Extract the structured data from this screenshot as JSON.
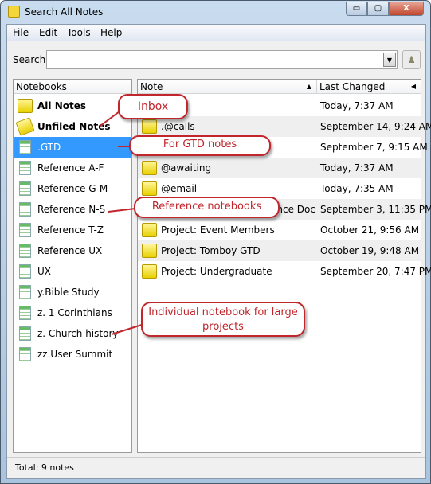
{
  "window": {
    "title": "Search All Notes",
    "buttons": {
      "minimize": "▭",
      "maximize": "▢",
      "close": "X"
    }
  },
  "menu": [
    {
      "label": "File",
      "key": "F",
      "rest": "ile"
    },
    {
      "label": "Edit",
      "key": "E",
      "rest": "dit"
    },
    {
      "label": "Tools",
      "key": "T",
      "rest": "ools"
    },
    {
      "label": "Help",
      "key": "H",
      "rest": "elp"
    }
  ],
  "search": {
    "label": "Search:",
    "value": "",
    "placeholder": ""
  },
  "notebooks": {
    "header": "Notebooks",
    "items": [
      {
        "label": "All Notes",
        "bold": true,
        "icon": "folder-icon"
      },
      {
        "label": "Unfiled Notes",
        "bold": true,
        "icon": "unfiled-folder-icon"
      },
      {
        "label": ".GTD",
        "selected": true,
        "icon": "notebook-icon"
      },
      {
        "label": "Reference A-F",
        "icon": "notebook-icon"
      },
      {
        "label": "Reference G-M",
        "icon": "notebook-icon"
      },
      {
        "label": "Reference N-S",
        "icon": "notebook-icon"
      },
      {
        "label": "Reference T-Z",
        "icon": "notebook-icon"
      },
      {
        "label": "Reference UX",
        "icon": "notebook-icon"
      },
      {
        "label": "UX",
        "icon": "notebook-icon"
      },
      {
        "label": "y.Bible Study",
        "icon": "notebook-icon"
      },
      {
        "label": "z. 1 Corinthians",
        "icon": "notebook-icon"
      },
      {
        "label": "z. Church history",
        "icon": "notebook-icon"
      },
      {
        "label": "zz.User Summit",
        "icon": "notebook-icon"
      }
    ]
  },
  "notes": {
    "columns": {
      "note": "Note",
      "changed": "Last Changed"
    },
    "sort": "ascending",
    "rows": [
      {
        "name": "",
        "changed": "Today, 7:37 AM"
      },
      {
        "name": ".@calls",
        "changed": "September 14, 9:24 AM"
      },
      {
        "name": "",
        "changed": "September 7, 9:15 AM"
      },
      {
        "name": "@awaiting",
        "changed": "Today, 7:37 AM"
      },
      {
        "name": "@email",
        "changed": "Today, 7:35 AM"
      },
      {
        "name": "nce Doc",
        "changed": "September 3, 11:35 PM"
      },
      {
        "name": "Project: Event Members",
        "changed": "October 21, 9:56 AM"
      },
      {
        "name": "Project: Tomboy GTD",
        "changed": "October 19, 9:48 AM"
      },
      {
        "name": "Project: Undergraduate",
        "changed": "September 20, 7:47 PM"
      }
    ]
  },
  "status": "Total: 9 notes",
  "callouts": {
    "inbox": "Inbox",
    "gtd": "For GTD notes",
    "reference": "Reference notebooks",
    "projects": "Individual notebook for large projects"
  },
  "colors": {
    "annotation": "#c0262c",
    "selection": "#3399ff"
  }
}
